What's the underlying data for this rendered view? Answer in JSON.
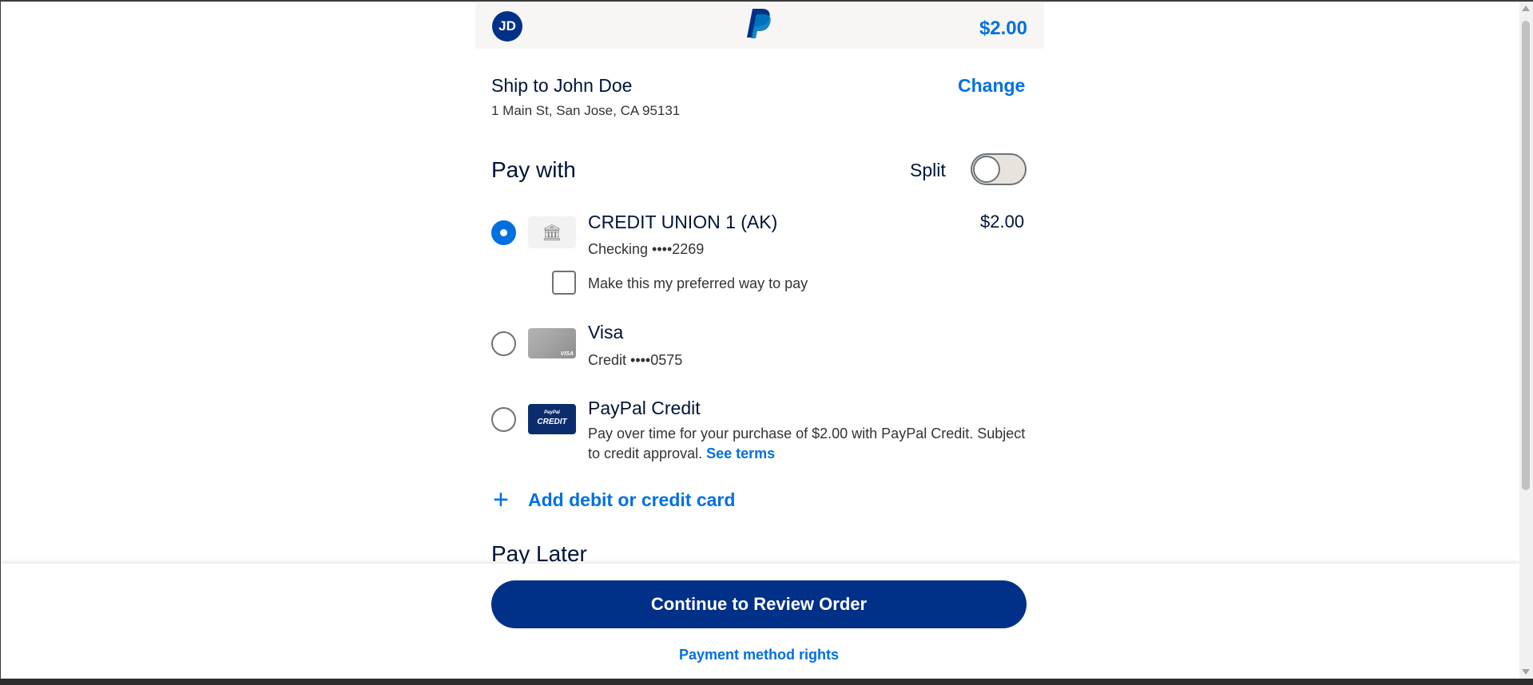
{
  "header": {
    "avatar_initials": "JD",
    "logo_icon": "paypal-logo",
    "amount": "$2.00"
  },
  "shipping": {
    "title": "Ship to John Doe",
    "address": "1 Main St, San Jose, CA 95131",
    "change_label": "Change"
  },
  "pay_with": {
    "title": "Pay with",
    "split_label": "Split",
    "split_enabled": false,
    "methods": [
      {
        "name": "CREDIT UNION 1 (AK)",
        "detail": "Checking ••••2269",
        "amount": "$2.00",
        "icon": "bank-icon",
        "selected": true
      },
      {
        "name": "Visa",
        "detail": "Credit ••••0575",
        "icon": "visa-card-icon",
        "selected": false
      },
      {
        "name": "PayPal Credit",
        "description": "Pay over time for your purchase of $2.00 with PayPal Credit. Subject to credit approval.",
        "see_terms": "See terms",
        "icon": "paypal-credit-icon",
        "icon_text_top": "PayPal",
        "icon_text_bottom": "CREDIT",
        "selected": false
      }
    ],
    "preferred_label": "Make this my preferred way to pay",
    "preferred_checked": false,
    "add_card_label": "Add debit or credit card"
  },
  "pay_later": {
    "title": "Pay Later"
  },
  "footer": {
    "continue_label": "Continue to Review Order",
    "rights_label": "Payment method rights"
  },
  "colors": {
    "brand_blue": "#003087",
    "link_blue": "#0070e0",
    "header_bg": "#f7f6f4"
  }
}
